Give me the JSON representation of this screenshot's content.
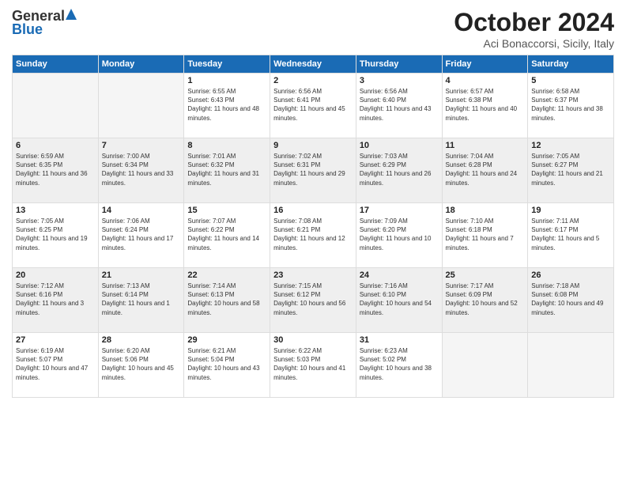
{
  "header": {
    "logo_general": "General",
    "logo_blue": "Blue",
    "month_title": "October 2024",
    "location": "Aci Bonaccorsi, Sicily, Italy"
  },
  "weekdays": [
    "Sunday",
    "Monday",
    "Tuesday",
    "Wednesday",
    "Thursday",
    "Friday",
    "Saturday"
  ],
  "weeks": [
    [
      {
        "day": "",
        "content": ""
      },
      {
        "day": "",
        "content": ""
      },
      {
        "day": "1",
        "content": "Sunrise: 6:55 AM\nSunset: 6:43 PM\nDaylight: 11 hours and 48 minutes."
      },
      {
        "day": "2",
        "content": "Sunrise: 6:56 AM\nSunset: 6:41 PM\nDaylight: 11 hours and 45 minutes."
      },
      {
        "day": "3",
        "content": "Sunrise: 6:56 AM\nSunset: 6:40 PM\nDaylight: 11 hours and 43 minutes."
      },
      {
        "day": "4",
        "content": "Sunrise: 6:57 AM\nSunset: 6:38 PM\nDaylight: 11 hours and 40 minutes."
      },
      {
        "day": "5",
        "content": "Sunrise: 6:58 AM\nSunset: 6:37 PM\nDaylight: 11 hours and 38 minutes."
      }
    ],
    [
      {
        "day": "6",
        "content": "Sunrise: 6:59 AM\nSunset: 6:35 PM\nDaylight: 11 hours and 36 minutes."
      },
      {
        "day": "7",
        "content": "Sunrise: 7:00 AM\nSunset: 6:34 PM\nDaylight: 11 hours and 33 minutes."
      },
      {
        "day": "8",
        "content": "Sunrise: 7:01 AM\nSunset: 6:32 PM\nDaylight: 11 hours and 31 minutes."
      },
      {
        "day": "9",
        "content": "Sunrise: 7:02 AM\nSunset: 6:31 PM\nDaylight: 11 hours and 29 minutes."
      },
      {
        "day": "10",
        "content": "Sunrise: 7:03 AM\nSunset: 6:29 PM\nDaylight: 11 hours and 26 minutes."
      },
      {
        "day": "11",
        "content": "Sunrise: 7:04 AM\nSunset: 6:28 PM\nDaylight: 11 hours and 24 minutes."
      },
      {
        "day": "12",
        "content": "Sunrise: 7:05 AM\nSunset: 6:27 PM\nDaylight: 11 hours and 21 minutes."
      }
    ],
    [
      {
        "day": "13",
        "content": "Sunrise: 7:05 AM\nSunset: 6:25 PM\nDaylight: 11 hours and 19 minutes."
      },
      {
        "day": "14",
        "content": "Sunrise: 7:06 AM\nSunset: 6:24 PM\nDaylight: 11 hours and 17 minutes."
      },
      {
        "day": "15",
        "content": "Sunrise: 7:07 AM\nSunset: 6:22 PM\nDaylight: 11 hours and 14 minutes."
      },
      {
        "day": "16",
        "content": "Sunrise: 7:08 AM\nSunset: 6:21 PM\nDaylight: 11 hours and 12 minutes."
      },
      {
        "day": "17",
        "content": "Sunrise: 7:09 AM\nSunset: 6:20 PM\nDaylight: 11 hours and 10 minutes."
      },
      {
        "day": "18",
        "content": "Sunrise: 7:10 AM\nSunset: 6:18 PM\nDaylight: 11 hours and 7 minutes."
      },
      {
        "day": "19",
        "content": "Sunrise: 7:11 AM\nSunset: 6:17 PM\nDaylight: 11 hours and 5 minutes."
      }
    ],
    [
      {
        "day": "20",
        "content": "Sunrise: 7:12 AM\nSunset: 6:16 PM\nDaylight: 11 hours and 3 minutes."
      },
      {
        "day": "21",
        "content": "Sunrise: 7:13 AM\nSunset: 6:14 PM\nDaylight: 11 hours and 1 minute."
      },
      {
        "day": "22",
        "content": "Sunrise: 7:14 AM\nSunset: 6:13 PM\nDaylight: 10 hours and 58 minutes."
      },
      {
        "day": "23",
        "content": "Sunrise: 7:15 AM\nSunset: 6:12 PM\nDaylight: 10 hours and 56 minutes."
      },
      {
        "day": "24",
        "content": "Sunrise: 7:16 AM\nSunset: 6:10 PM\nDaylight: 10 hours and 54 minutes."
      },
      {
        "day": "25",
        "content": "Sunrise: 7:17 AM\nSunset: 6:09 PM\nDaylight: 10 hours and 52 minutes."
      },
      {
        "day": "26",
        "content": "Sunrise: 7:18 AM\nSunset: 6:08 PM\nDaylight: 10 hours and 49 minutes."
      }
    ],
    [
      {
        "day": "27",
        "content": "Sunrise: 6:19 AM\nSunset: 5:07 PM\nDaylight: 10 hours and 47 minutes."
      },
      {
        "day": "28",
        "content": "Sunrise: 6:20 AM\nSunset: 5:06 PM\nDaylight: 10 hours and 45 minutes."
      },
      {
        "day": "29",
        "content": "Sunrise: 6:21 AM\nSunset: 5:04 PM\nDaylight: 10 hours and 43 minutes."
      },
      {
        "day": "30",
        "content": "Sunrise: 6:22 AM\nSunset: 5:03 PM\nDaylight: 10 hours and 41 minutes."
      },
      {
        "day": "31",
        "content": "Sunrise: 6:23 AM\nSunset: 5:02 PM\nDaylight: 10 hours and 38 minutes."
      },
      {
        "day": "",
        "content": ""
      },
      {
        "day": "",
        "content": ""
      }
    ]
  ]
}
